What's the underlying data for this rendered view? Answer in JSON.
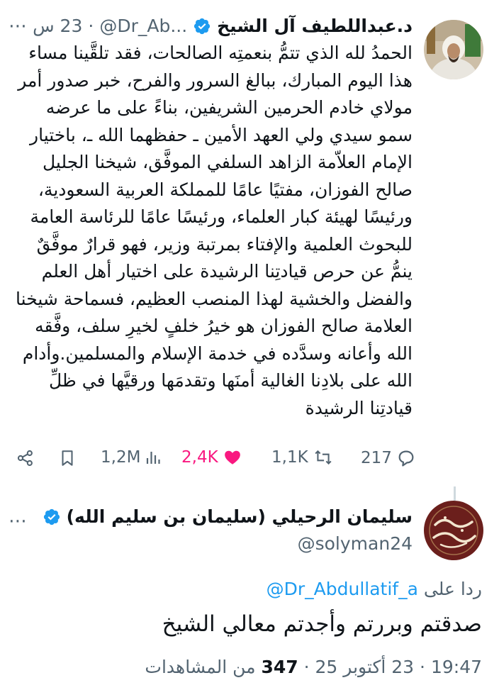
{
  "tweet": {
    "author_name": "د.عبداللطيف آل الشيخ",
    "handle": "@Dr_Ab...",
    "separator": "·",
    "time": "23 س",
    "verified_icon": "verified-badge-icon",
    "lines": [
      "الحمدُ لله الذي تتمُّ بنعمتِه الصالحات، فقد تلقَّينا مساء",
      "هذا اليوم المبارك، ببالغ السرور والفرح، خبر صدور أمر",
      "مولاي خادم الحرمين الشريفين، بناءً على ما عرضه",
      "سمو سيدي ولي العهد الأمين ـ حفظهما الله ـ، باختيار",
      "الإمام العلاّمة الزاهد السلفي الموفَّق، شيخنا الجليل",
      "صالح الفوزان، مفتيًا عامًا للمملكة العربية السعودية،",
      "ورئيسًا لهيئة كبار العلماء، ورئيسًا عامًا للرئاسة العامة",
      "للبحوث العلمية والإفتاء بمرتبة وزير، فهو قرارٌ موفَّقٌ",
      "ينمُّ عن حرص قيادتِنا الرشيدة على اختيار أهل العلم",
      "والفضل والخشية لهذا المنصب العظيم، فسماحة شيخنا",
      "العلامة صالح الفوزان هو خيرُ خلفٍ لخيرِ سلف، وفَّقه",
      "الله وأعانه وسدَّده في خدمة الإسلام والمسلمين.وأدام",
      "الله على بلادِنا الغالية أمنَها وتقدمَها ورقيَّها في ظلِّ",
      "قيادتِنا الرشيدة"
    ],
    "stats": {
      "replies": "217",
      "retweets": "1,1K",
      "likes": "2,4K",
      "views": "1,2M"
    }
  },
  "reply": {
    "author_name": "سليمان الرحيلي (سليمان بن سليم الله)",
    "handle": "@solyman24",
    "avatar_text": "سليمان الرحيلي",
    "replying_prefix": "ردا على",
    "replying_to": "@Dr_Abdullatif_a",
    "text": "صدقتم وبررتم وأجدتم معالي الشيخ",
    "time": "19:47",
    "date": "23 أكتوبر 25",
    "views_count": "347",
    "views_label": "من المشاهدات",
    "separator": "·"
  },
  "colors": {
    "text": "#0f1419",
    "secondary": "#536471",
    "accent": "#1d9bf0",
    "like": "#f91880"
  }
}
